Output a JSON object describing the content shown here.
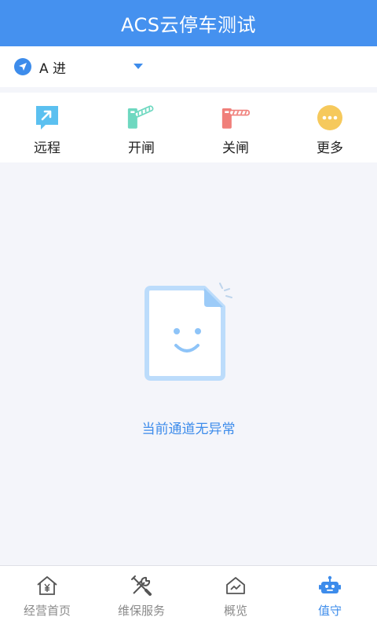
{
  "header": {
    "title": "ACS云停车测试"
  },
  "lane": {
    "name": "A 进"
  },
  "actions": [
    {
      "label": "远程",
      "icon": "remote-icon",
      "color": "#5bc0f0"
    },
    {
      "label": "开闸",
      "icon": "open-gate-icon",
      "color": "#6ed8c0"
    },
    {
      "label": "关闸",
      "icon": "close-gate-icon",
      "color": "#f07f7a"
    },
    {
      "label": "更多",
      "icon": "more-icon",
      "color": "#f6c95c"
    }
  ],
  "empty_state": {
    "icon": "empty-document-icon",
    "text": "当前通道无异常"
  },
  "tabs": [
    {
      "label": "经营首页",
      "icon": "home-yuan-icon",
      "active": false
    },
    {
      "label": "维保服务",
      "icon": "tools-icon",
      "active": false
    },
    {
      "label": "概览",
      "icon": "overview-icon",
      "active": false
    },
    {
      "label": "值守",
      "icon": "robot-icon",
      "active": true
    }
  ],
  "colors": {
    "primary": "#4591ef",
    "accent": "#3d8ceb",
    "background": "#f4f5fa"
  }
}
